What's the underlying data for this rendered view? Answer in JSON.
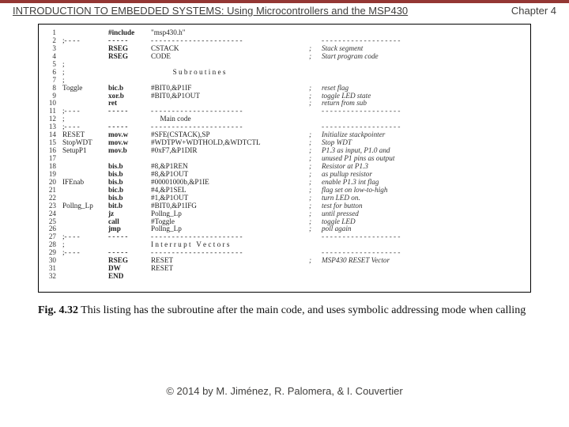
{
  "header": {
    "title": "INTRODUCTION TO EMBEDDED SYSTEMS: Using Microcontrollers and the MSP430",
    "chapter": "Chapter 4"
  },
  "code": {
    "lines": [
      {
        "n": "1",
        "lbl": "",
        "op": "#include",
        "arg": "\"msp430.h\"",
        "sc": "",
        "c": ""
      },
      {
        "n": "2",
        "lbl": ";- - - -",
        "op": "- - - - -",
        "arg": "- - - - - - - - - - - - - - - - - - - - - -",
        "sc": "",
        "c": "- - - - - - - - - - - - - - - - - - -"
      },
      {
        "n": "3",
        "lbl": "",
        "op": "RSEG",
        "arg": "CSTACK",
        "sc": ";",
        "c": "Stack segment"
      },
      {
        "n": "4",
        "lbl": "",
        "op": "RSEG",
        "arg": "CODE",
        "sc": ";",
        "c": "Start program code"
      },
      {
        "n": "5",
        "lbl": ";",
        "op": "",
        "arg": "",
        "sc": "",
        "c": ""
      },
      {
        "n": "6",
        "lbl": ";",
        "op": "",
        "arg": "            S u b r o u t i n e s",
        "sc": "",
        "c": ""
      },
      {
        "n": "7",
        "lbl": ";",
        "op": "",
        "arg": "",
        "sc": "",
        "c": ""
      },
      {
        "n": "8",
        "lbl": "Toggle",
        "op": "bic.b",
        "arg": "#BIT0,&P1IF",
        "sc": ";",
        "c": "reset flag"
      },
      {
        "n": "9",
        "lbl": "",
        "op": "xor.b",
        "arg": "#BIT0,&P1OUT",
        "sc": ";",
        "c": "toggle LED state"
      },
      {
        "n": "10",
        "lbl": "",
        "op": "ret",
        "arg": "",
        "sc": ";",
        "c": "return from sub"
      },
      {
        "n": "11",
        "lbl": ";- - - -",
        "op": "- - - - -",
        "arg": "- - - - - - - - - - - - - - - - - - - - - -",
        "sc": "",
        "c": "- - - - - - - - - - - - - - - - - - -"
      },
      {
        "n": "12",
        "lbl": ";",
        "op": "",
        "arg": "     Main code",
        "sc": "",
        "c": ""
      },
      {
        "n": "13",
        "lbl": ";- - - -",
        "op": "- - - - -",
        "arg": "- - - - - - - - - - - - - - - - - - - - - -",
        "sc": "",
        "c": "- - - - - - - - - - - - - - - - - - -"
      },
      {
        "n": "14",
        "lbl": "RESET",
        "op": "mov.w",
        "arg": "#SFE(CSTACK),SP",
        "sc": ";",
        "c": "Initialize stackpointer"
      },
      {
        "n": "15",
        "lbl": "StopWDT",
        "op": "mov.w",
        "arg": "#WDTPW+WDTHOLD,&WDTCTL",
        "sc": ";",
        "c": "Stop WDT"
      },
      {
        "n": "16",
        "lbl": "SetupP1",
        "op": "mov.b",
        "arg": "#0xF7,&P1DIR",
        "sc": ";",
        "c": "P1.3 as input, P1.0 and"
      },
      {
        "n": "17",
        "lbl": "",
        "op": "",
        "arg": "",
        "sc": ";",
        "c": "unused P1 pins as output"
      },
      {
        "n": "18",
        "lbl": "",
        "op": "bis.b",
        "arg": "#8,&P1REN",
        "sc": ";",
        "c": "Resistor at P1.3"
      },
      {
        "n": "19",
        "lbl": "",
        "op": "bis.b",
        "arg": "#8,&P1OUT",
        "sc": ";",
        "c": "as pullup resistor"
      },
      {
        "n": "20",
        "lbl": "IFEnab",
        "op": "bis.b",
        "arg": "#00001000b,&P1IE",
        "sc": ";",
        "c": "enable P1.3 int flag"
      },
      {
        "n": "21",
        "lbl": "",
        "op": "bic.b",
        "arg": "#4,&P1SEL",
        "sc": ";",
        "c": "flag set on low-to-high"
      },
      {
        "n": "22",
        "lbl": "",
        "op": "bis.b",
        "arg": "#1,&P1OUT",
        "sc": ";",
        "c": "turn LED on."
      },
      {
        "n": "23",
        "lbl": "Pollng_Lp",
        "op": "bit.b",
        "arg": "#BIT0,&P1IFG",
        "sc": ";",
        "c": "test for button"
      },
      {
        "n": "24",
        "lbl": "",
        "op": "jz",
        "arg": "Pollng_Lp",
        "sc": ";",
        "c": "until pressed"
      },
      {
        "n": "25",
        "lbl": "",
        "op": "call",
        "arg": "#Toggle",
        "sc": ";",
        "c": "toggle LED"
      },
      {
        "n": "26",
        "lbl": "",
        "op": "jmp",
        "arg": "Pollng_Lp",
        "sc": ";",
        "c": "poll again"
      },
      {
        "n": "27",
        "lbl": ";- - - -",
        "op": "- - - - -",
        "arg": "- - - - - - - - - - - - - - - - - - - - - -",
        "sc": "",
        "c": "- - - - - - - - - - - - - - - - - - -"
      },
      {
        "n": "28",
        "lbl": ";",
        "op": "",
        "arg": "I n t e r r u p t   V e c t o r s",
        "sc": "",
        "c": ""
      },
      {
        "n": "29",
        "lbl": ";- - - -",
        "op": "- - - - -",
        "arg": "- - - - - - - - - - - - - - - - - - - - - -",
        "sc": "",
        "c": "- - - - - - - - - - - - - - - - - - -"
      },
      {
        "n": "30",
        "lbl": "",
        "op": "RSEG",
        "arg": "RESET",
        "sc": ";",
        "c": "MSP430 RESET Vector"
      },
      {
        "n": "31",
        "lbl": "",
        "op": "DW",
        "arg": "RESET",
        "sc": "",
        "c": ""
      },
      {
        "n": "32",
        "lbl": "",
        "op": "END",
        "arg": "",
        "sc": "",
        "c": ""
      }
    ]
  },
  "caption": {
    "label": "Fig. 4.32",
    "text": "   This listing has the subroutine after the main code, and uses symbolic addressing mode when calling"
  },
  "footer": {
    "text": "© 2014 by M. Jiménez, R. Palomera, & I. Couvertier"
  }
}
